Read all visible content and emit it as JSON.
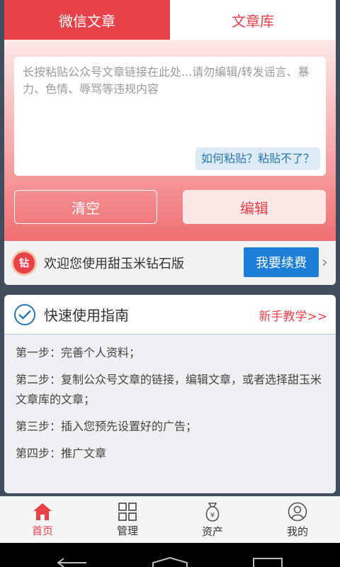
{
  "tabs": {
    "active": "微信文章",
    "inactive": "文章库"
  },
  "editor": {
    "placeholder": "长按粘贴公众号文章链接在此处...请勿编辑/转发谣言、暴力、色情、辱骂等违规内容",
    "help": "如何粘贴？粘贴不了？"
  },
  "buttons": {
    "clear": "清空",
    "edit": "编辑"
  },
  "promo": {
    "badge": "钻",
    "text": "欢迎您使用甜玉米钻石版",
    "renew": "我要续费"
  },
  "guide": {
    "title": "快速使用指南",
    "tutorial": "新手教学>>",
    "steps": [
      "第一步：完善个人资料；",
      "第二步：复制公众号文章的链接，编辑文章，或者选择甜玉米文章库的文章；",
      "第三步：插入您预先设置好的广告；",
      "第四步：推广文章"
    ]
  },
  "nav": {
    "home": "首页",
    "manage": "管理",
    "assets": "资产",
    "mine": "我的"
  },
  "colors": {
    "accent": "#e8414a",
    "blue": "#1c7ed6"
  }
}
